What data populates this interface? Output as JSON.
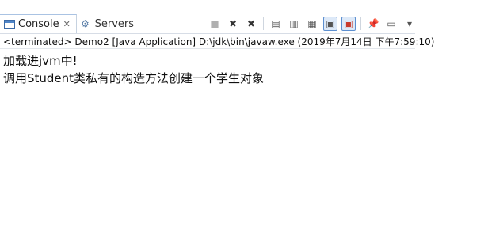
{
  "tabs": [
    {
      "label": "Console",
      "icon": "console-icon",
      "closable": true
    },
    {
      "label": "Servers",
      "icon": "servers-icon"
    }
  ],
  "toolbar": {
    "buttons": [
      {
        "icon": "terminate-icon"
      },
      {
        "icon": "remove-launch-icon"
      },
      {
        "icon": "remove-all-terminated-icon"
      },
      {
        "icon": "clear-console-icon"
      },
      {
        "icon": "scroll-lock-icon"
      },
      {
        "icon": "word-wrap-icon"
      },
      {
        "icon": "show-console-stdout-icon"
      },
      {
        "icon": "show-console-stderr-icon"
      },
      {
        "icon": "pin-console-icon"
      },
      {
        "icon": "display-selected-console-icon"
      },
      {
        "icon": "dropdown-arrow-icon"
      }
    ]
  },
  "status": "<terminated> Demo2 [Java Application] D:\\jdk\\bin\\javaw.exe (2019年7月14日 下午7:59:10)",
  "output": [
    "加载进jvm中!",
    "调用Student类私有的构造方法创建一个学生对象"
  ],
  "colors": {
    "tab_border": "#aac3e3",
    "active_button": "#5c8fd0",
    "stop_red": "#c83a2c",
    "arc_blue": "#2c5fb8"
  }
}
